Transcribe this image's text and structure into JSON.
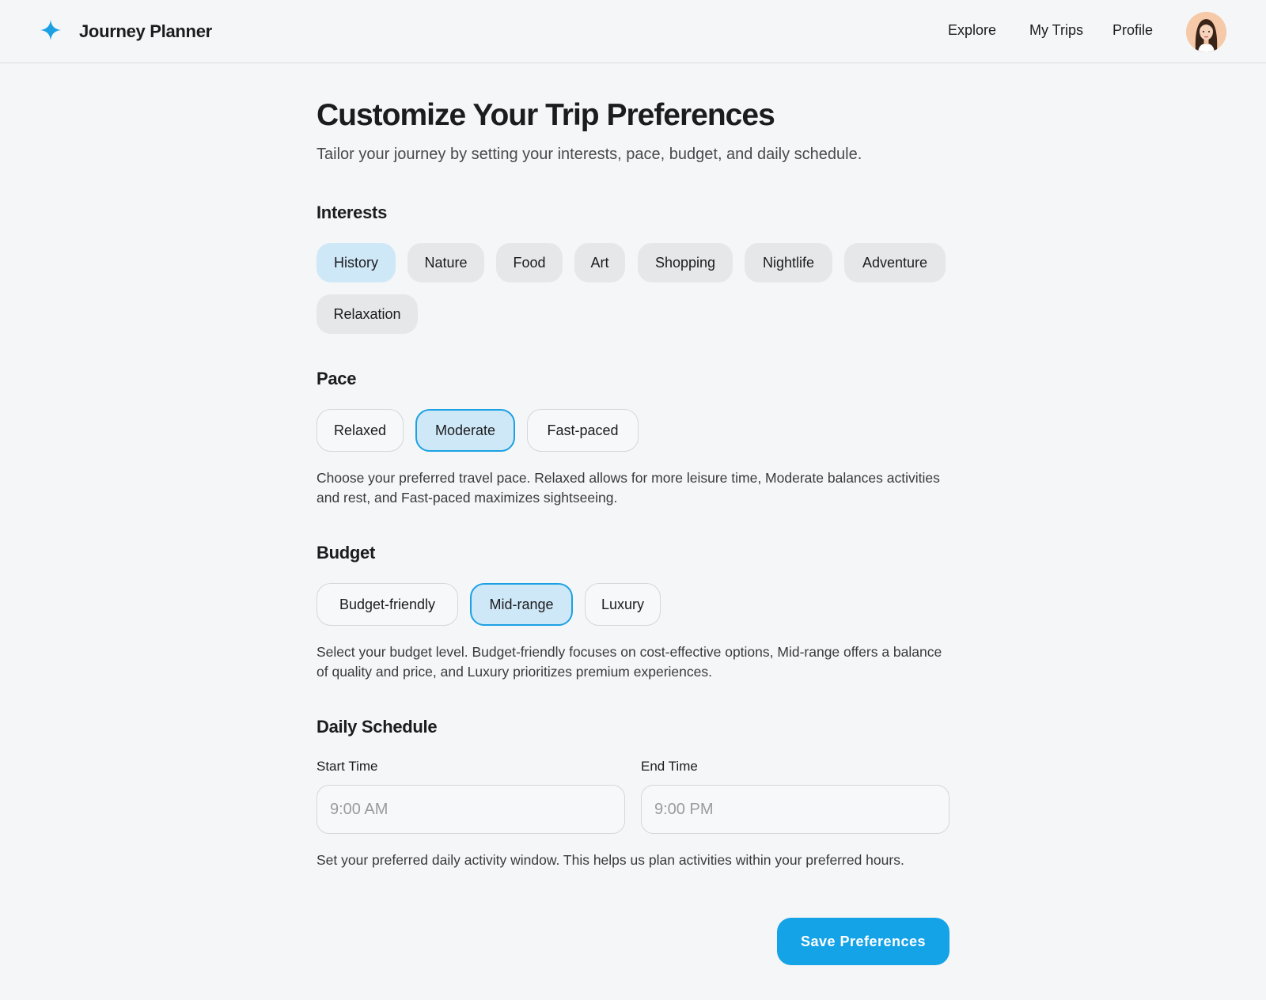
{
  "header": {
    "brand_icon": "sparkle-icon",
    "brand_color": "#1ba1e3",
    "title": "Journey Planner",
    "nav": [
      "Explore",
      "My Trips",
      "Profile"
    ],
    "avatar_icon": "user-avatar"
  },
  "page": {
    "title": "Customize Your Trip Preferences",
    "subtitle": "Tailor your journey by setting your interests, pace, budget, and daily schedule."
  },
  "interests": {
    "title": "Interests",
    "options": [
      "History",
      "Nature",
      "Food",
      "Art",
      "Shopping",
      "Nightlife",
      "Adventure",
      "Relaxation"
    ],
    "selected": [
      "History"
    ]
  },
  "pace": {
    "title": "Pace",
    "options": [
      "Relaxed",
      "Moderate",
      "Fast-paced"
    ],
    "selected": "Moderate",
    "help": "Choose your preferred travel pace. Relaxed allows for more leisure time, Moderate balances activities and rest, and Fast-paced maximizes sightseeing."
  },
  "budget": {
    "title": "Budget",
    "options": [
      "Budget-friendly",
      "Mid-range",
      "Luxury"
    ],
    "selected": "Mid-range",
    "help": "Select your budget level. Budget-friendly focuses on cost-effective options, Mid-range offers a balance of quality and price, and Luxury prioritizes premium experiences."
  },
  "schedule": {
    "title": "Daily Schedule",
    "start_label": "Start Time",
    "start_placeholder": "9:00 AM",
    "end_label": "End Time",
    "end_placeholder": "9:00 PM",
    "help": "Set your preferred daily activity window. This helps us plan activities within your preferred hours."
  },
  "actions": {
    "save_label": "Save Preferences",
    "accent_color": "#15a3e8"
  }
}
